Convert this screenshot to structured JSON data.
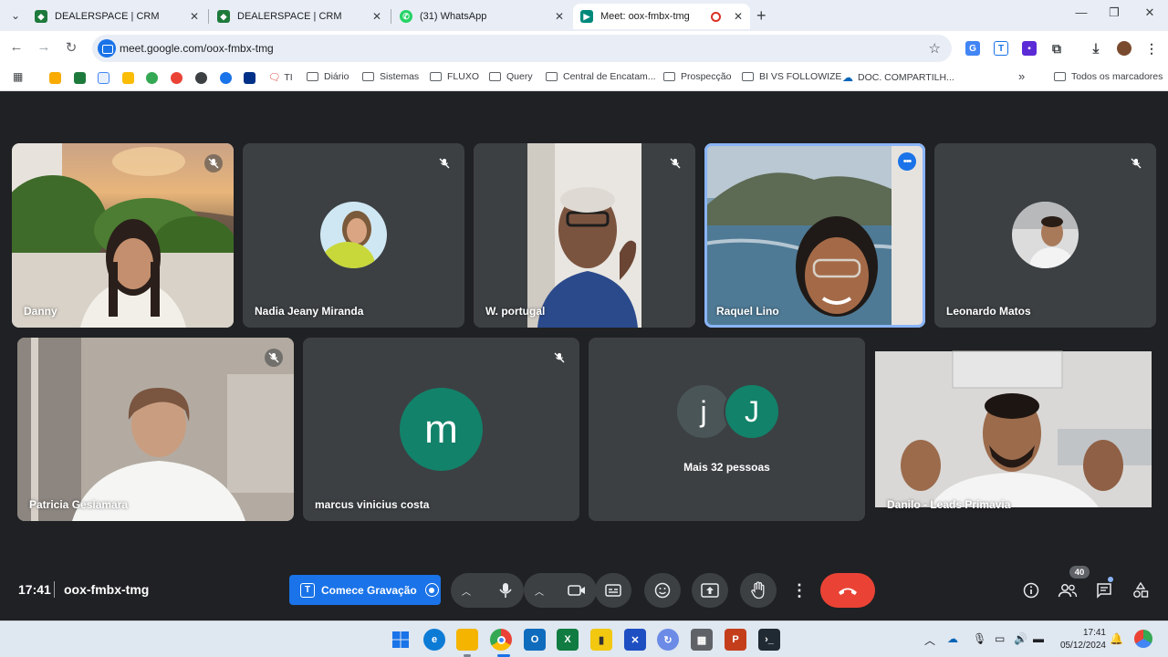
{
  "browser": {
    "tabs": [
      {
        "title": "DEALERSPACE | CRM",
        "favicon": "dealerspace-icon",
        "active": false
      },
      {
        "title": "DEALERSPACE | CRM",
        "favicon": "dealerspace-icon",
        "active": false
      },
      {
        "title": "(31) WhatsApp",
        "favicon": "whatsapp-icon",
        "active": false
      },
      {
        "title": "Meet: oox-fmbx-tmg",
        "favicon": "meet-icon",
        "active": true
      }
    ],
    "url": "meet.google.com/oox-fmbx-tmg",
    "bookmarks": [
      {
        "label": "TI",
        "icon": "chat-icon"
      },
      {
        "label": "Diário",
        "icon": "folder-icon"
      },
      {
        "label": "Sistemas",
        "icon": "folder-icon"
      },
      {
        "label": "FLUXO",
        "icon": "folder-icon"
      },
      {
        "label": "Query",
        "icon": "folder-icon"
      },
      {
        "label": "Central de Encatam...",
        "icon": "folder-icon"
      },
      {
        "label": "Prospecção",
        "icon": "folder-icon"
      },
      {
        "label": "BI VS FOLLOWIZE",
        "icon": "folder-icon"
      },
      {
        "label": "DOC. COMPARTILH...",
        "icon": "cloud-icon"
      }
    ],
    "all_bookmarks": "Todos os marcadores",
    "overflow": "»"
  },
  "meet": {
    "participants": [
      {
        "name": "Danny",
        "muted": true
      },
      {
        "name": "Nadia Jeany Miranda",
        "muted": true
      },
      {
        "name": "W. portugal",
        "muted": true
      },
      {
        "name": "Raquel Lino",
        "muted": false,
        "speaking": true
      },
      {
        "name": "Leonardo Matos",
        "muted": true
      },
      {
        "name": "Patricia Gesiamara",
        "muted": true
      },
      {
        "name": "marcus vinicius costa",
        "muted": true,
        "avatar_letter": "m"
      },
      {
        "name": "Danilo - Leads Primavia",
        "muted": false
      }
    ],
    "others": {
      "letters": [
        "j",
        "J"
      ],
      "label": "Mais 32 pessoas"
    },
    "time": "17:41",
    "code": "oox-fmbx-tmg",
    "record_label": "Comece Gravação",
    "people_count": "40",
    "colors": {
      "accent": "#1a73e8",
      "hangup": "#ea4335",
      "avatar_teal": "#12826a",
      "stage": "#202124",
      "tile": "#3c4043"
    }
  },
  "taskbar": {
    "time": "17:41",
    "date": "05/12/2024"
  }
}
